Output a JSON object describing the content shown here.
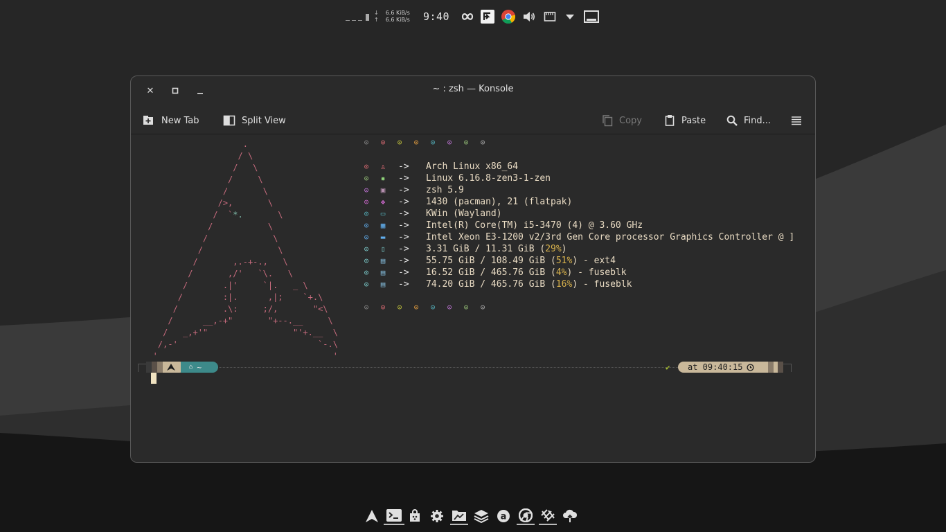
{
  "topbar": {
    "net_down": "6.6 KiB/s",
    "net_up": "6.6 KiB/s",
    "clock": "9:40"
  },
  "window": {
    "title": "~ : zsh — Konsole"
  },
  "toolbar": {
    "new_tab": "New Tab",
    "split_view": "Split View",
    "copy": "Copy",
    "paste": "Paste",
    "find": "Find..."
  },
  "terminal": {
    "fetch": [
      {
        "bullet_color": "#e06c75",
        "icon": "tux-icon",
        "icon_color": "#e06c75",
        "arrow": "->",
        "text": "Arch Linux x86_64"
      },
      {
        "bullet_color": "#98c379",
        "icon": "gear-icon",
        "icon_color": "#8fd27a",
        "arrow": "->",
        "text": "Linux 6.16.8-zen3-1-zen"
      },
      {
        "bullet_color": "#c678dd",
        "icon": "shell-icon",
        "icon_color": "#b48ead",
        "arrow": "->",
        "text": "zsh 5.9"
      },
      {
        "bullet_color": "#d46bd4",
        "icon": "package-icon",
        "icon_color": "#d46bd4",
        "arrow": "->",
        "text": "1430 (pacman), 21 (flatpak)"
      },
      {
        "bullet_color": "#56b6c2",
        "icon": "window-icon",
        "icon_color": "#56b6c2",
        "arrow": "->",
        "text": "KWin (Wayland)"
      },
      {
        "bullet_color": "#61afef",
        "icon": "cpu-icon",
        "icon_color": "#61afef",
        "arrow": "->",
        "text": "Intel(R) Core(TM) i5-3470 (4) @ 3.60 GHz"
      },
      {
        "bullet_color": "#61afef",
        "icon": "gpu-icon",
        "icon_color": "#61afef",
        "arrow": "->",
        "text": "Intel Xeon E3-1200 v2/3rd Gen Core processor Graphics Controller @ ]"
      },
      {
        "bullet_color": "#7fd1d1",
        "icon": "memory-icon",
        "icon_color": "#7fd1d1",
        "arrow": "->",
        "text_a": "3.31 GiB / 11.31 GiB (",
        "pct": "29%",
        "text_b": ")"
      },
      {
        "bullet_color": "#7fd1d1",
        "icon": "disk-icon",
        "icon_color": "#7fb4d1",
        "arrow": "->",
        "text_a": "55.75 GiB / 108.49 GiB (",
        "pct": "51%",
        "text_b": ") - ext4"
      },
      {
        "bullet_color": "#7fd1d1",
        "icon": "disk-icon",
        "icon_color": "#7fb4d1",
        "arrow": "->",
        "text_a": "16.52 GiB / 465.76 GiB (",
        "pct": "4%",
        "text_b": ") - fuseblk"
      },
      {
        "bullet_color": "#7fd1d1",
        "icon": "disk-icon",
        "icon_color": "#7fb4d1",
        "arrow": "->",
        "text_a": "74.20 GiB / 465.76 GiB (",
        "pct": "16%",
        "text_b": ") - fuseblk"
      }
    ],
    "palette": [
      "#8a8a8a",
      "#e06c75",
      "#c8c83c",
      "#e8a040",
      "#56b6c2",
      "#c678dd",
      "#98c379",
      "#b0b0b0"
    ],
    "prompt": {
      "dir": "~",
      "status": "✔",
      "time": "at 09:40:15"
    }
  },
  "colors": {
    "accent_teal": "#3d8a8a",
    "prompt_tan": "#c9b89a",
    "pct_yellow": "#d9b24c"
  }
}
